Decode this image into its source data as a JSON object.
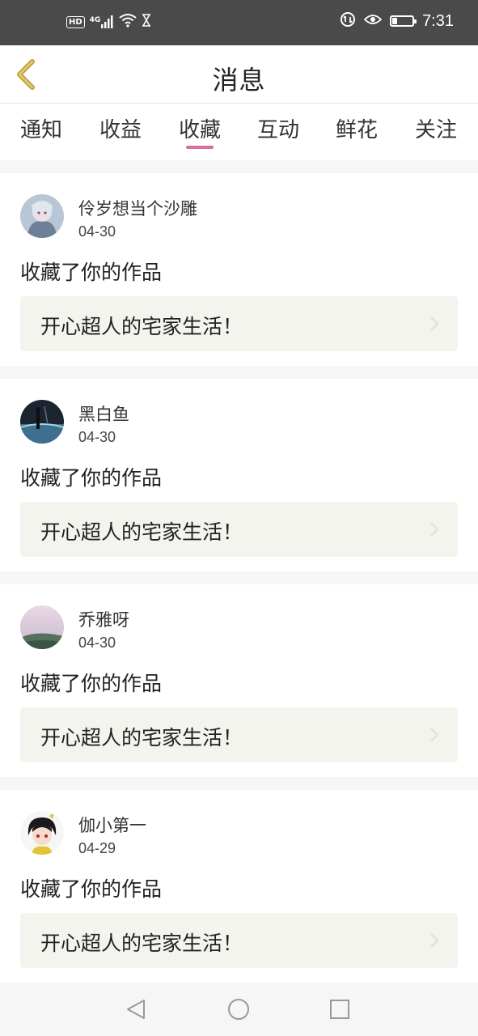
{
  "status_bar": {
    "hd": "HD",
    "network": "4G",
    "time": "7:31",
    "battery_level": 0.25
  },
  "header": {
    "title": "消息"
  },
  "tabs": [
    {
      "label": "通知",
      "active": false
    },
    {
      "label": "收益",
      "active": false
    },
    {
      "label": "收藏",
      "active": true
    },
    {
      "label": "互动",
      "active": false
    },
    {
      "label": "鲜花",
      "active": false
    },
    {
      "label": "关注",
      "active": false
    }
  ],
  "accent_color": "#d96ea0",
  "messages": [
    {
      "user": "伶岁想当个沙雕",
      "date": "04-30",
      "action": "收藏了你的作品",
      "work_title": "开心超人的宅家生活！"
    },
    {
      "user": "黑白鱼",
      "date": "04-30",
      "action": "收藏了你的作品",
      "work_title": "开心超人的宅家生活！"
    },
    {
      "user": "乔雅呀",
      "date": "04-30",
      "action": "收藏了你的作品",
      "work_title": "开心超人的宅家生活！"
    },
    {
      "user": "伽小第一",
      "date": "04-29",
      "action": "收藏了你的作品",
      "work_title": "开心超人的宅家生活！"
    }
  ]
}
